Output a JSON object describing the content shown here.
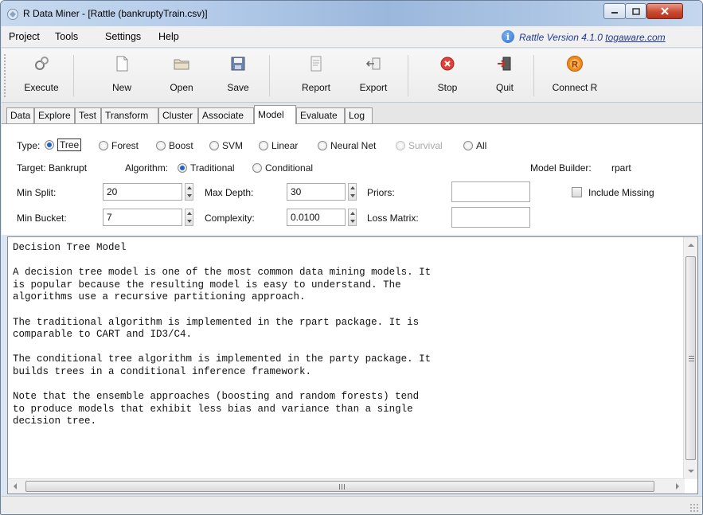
{
  "window": {
    "title": "R Data Miner - [Rattle (bankruptyTrain.csv)]"
  },
  "menu": {
    "items": [
      "Project",
      "Tools",
      "Settings",
      "Help"
    ],
    "version_text": "Rattle Version 4.1.0 ",
    "version_link": "togaware.com"
  },
  "toolbar": {
    "buttons": [
      {
        "label": "Execute",
        "icon": "execute-icon"
      },
      {
        "label": "New",
        "icon": "new-document-icon"
      },
      {
        "label": "Open",
        "icon": "open-folder-icon"
      },
      {
        "label": "Save",
        "icon": "save-icon"
      },
      {
        "label": "Report",
        "icon": "report-icon"
      },
      {
        "label": "Export",
        "icon": "export-icon"
      },
      {
        "label": "Stop",
        "icon": "stop-icon"
      },
      {
        "label": "Quit",
        "icon": "quit-icon"
      },
      {
        "label": "Connect R",
        "icon": "r-logo-icon"
      }
    ]
  },
  "tabs": [
    "Data",
    "Explore",
    "Test",
    "Transform",
    "Cluster",
    "Associate",
    "Model",
    "Evaluate",
    "Log"
  ],
  "active_tab": "Model",
  "model_options": {
    "type_label": "Type:",
    "types": [
      "Tree",
      "Forest",
      "Boost",
      "SVM",
      "Linear",
      "Neural Net",
      "Survival",
      "All"
    ],
    "selected_type": "Tree",
    "disabled_type": "Survival",
    "target_label": "Target: Bankrupt",
    "algorithm_label": "Algorithm:",
    "algorithms": [
      "Traditional",
      "Conditional"
    ],
    "selected_algorithm": "Traditional",
    "builder_label": "Model Builder:",
    "builder_value": "rpart"
  },
  "params": {
    "min_split_label": "Min Split:",
    "min_split": "20",
    "max_depth_label": "Max Depth:",
    "max_depth": "30",
    "priors_label": "Priors:",
    "priors": "",
    "include_missing_label": "Include Missing",
    "include_missing_checked": false,
    "min_bucket_label": "Min Bucket:",
    "min_bucket": "7",
    "complexity_label": "Complexity:",
    "complexity": "0.0100",
    "loss_matrix_label": "Loss Matrix:",
    "loss_matrix": ""
  },
  "output_text": "Decision Tree Model\n\nA decision tree model is one of the most common data mining models. It\nis popular because the resulting model is easy to understand. The\nalgorithms use a recursive partitioning approach.\n\nThe traditional algorithm is implemented in the rpart package. It is\ncomparable to CART and ID3/C4.\n\nThe conditional tree algorithm is implemented in the party package. It\nbuilds trees in a conditional inference framework.\n\nNote that the ensemble approaches (boosting and random forests) tend\nto produce models that exhibit less bias and variance than a single\ndecision tree."
}
